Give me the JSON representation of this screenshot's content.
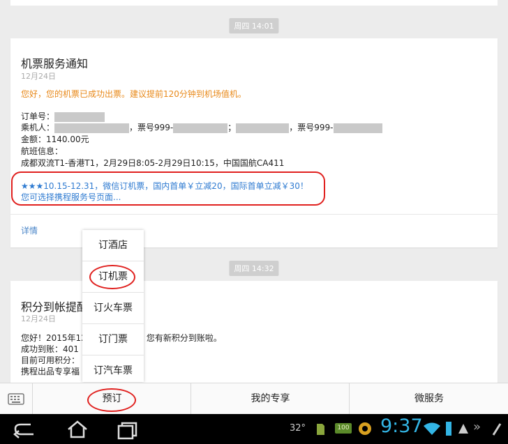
{
  "timestamps": {
    "first": "周四 14:01",
    "second": "周四 14:32"
  },
  "card1": {
    "title": "机票服务通知",
    "date": "12月24日",
    "greeting": "您好，您的机票已成功出票。建议提前120分钟到机场值机。",
    "order_label": "订单号：",
    "passenger_label": "乘机人：",
    "ticket_prefix": "，票号999-",
    "semicolon": "；",
    "amount": "金额：1140.00元",
    "flight_label": "航班信息：",
    "flight_detail": "成都双流T1-香港T1，2月29日8:05-2月29日10:15，中国国航CA411",
    "promo_line1": "★★★10.15-12.31，微信订机票，国内首单￥立减20，国际首单立减￥30！",
    "promo_line2": "您可选择携程服务号页面...",
    "details_link": "详情"
  },
  "card2": {
    "title": "积分到帐提醒",
    "date": "12月24日",
    "line1_left": "您好！2015年12",
    "line1_right": "您有新积分到账啦。",
    "line2": "成功到账：401",
    "line3": "目前可用积分：",
    "line4": "携程出品专享福"
  },
  "menu": {
    "items": [
      "订酒店",
      "订机票",
      "订火车票",
      "订门票",
      "订汽车票"
    ]
  },
  "bottom_tabs": {
    "tab1": "预订",
    "tab2": "我的专享",
    "tab3": "微服务"
  },
  "status_bar": {
    "temperature": "32°",
    "battery_badge": "100",
    "clock": "9:37"
  },
  "colors": {
    "accent_orange": "#e8891a",
    "link_blue": "#2f7bd1",
    "annotation_red": "#e0201e"
  }
}
